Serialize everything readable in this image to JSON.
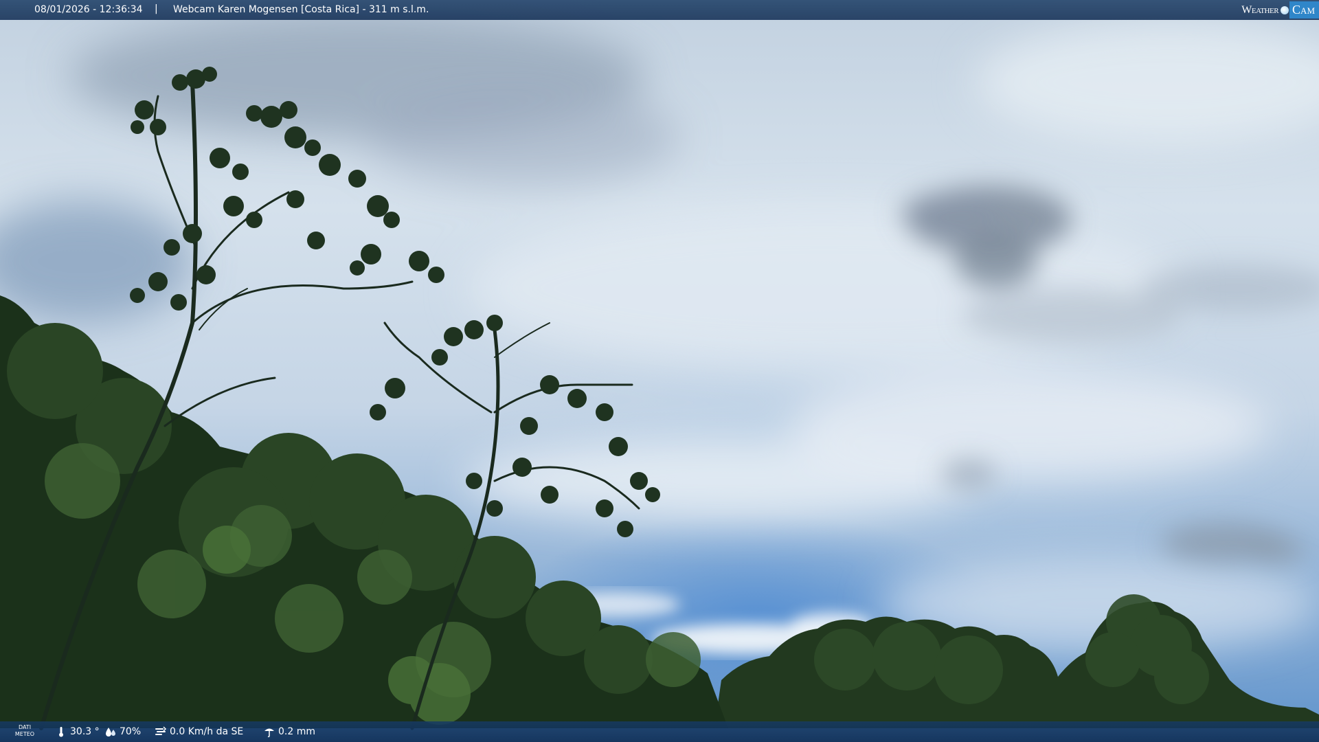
{
  "header": {
    "timestamp": "08/01/2026 - 12:36:34",
    "separator": "|",
    "camera_title": "Webcam Karen Mogensen [Costa Rica] - 311 m s.l.m."
  },
  "logo": {
    "word_left": "Weather",
    "word_right": "Cam",
    "accent": "#2f86c9"
  },
  "footer": {
    "dati_label_1": "DATI",
    "dati_label_2": "METEO",
    "temperature": "30.3 °",
    "humidity": "70%",
    "wind": "0.0 Km/h da SE",
    "rain": "0.2 mm",
    "icons": [
      "thermometer-icon",
      "humidity-drops-icon",
      "wind-icon",
      "rain-gauge-icon"
    ]
  },
  "colors": {
    "bar_bg": "#1c375c",
    "sky_blue": "#5f93cc",
    "foliage": "#1f3a1d"
  }
}
